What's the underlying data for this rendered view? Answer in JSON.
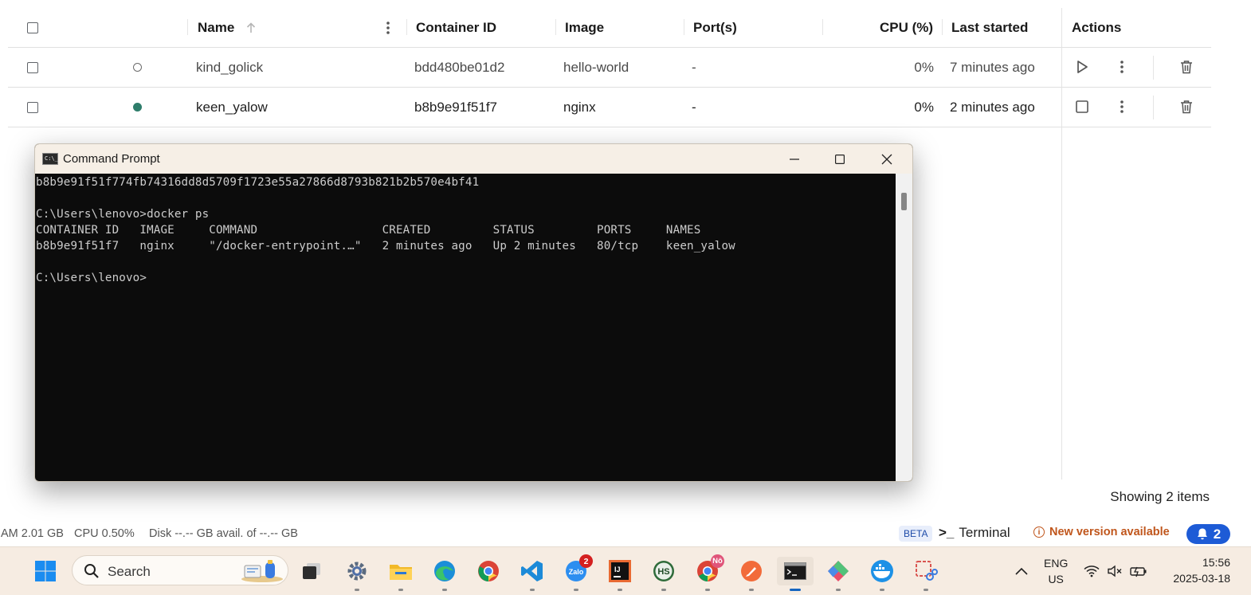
{
  "table": {
    "headers": {
      "name": "Name",
      "container_id": "Container ID",
      "image": "Image",
      "ports": "Port(s)",
      "cpu": "CPU (%)",
      "last_started": "Last started",
      "actions": "Actions"
    },
    "rows": [
      {
        "status": "stopped",
        "name": "kind_golick",
        "container_id": "bdd480be01d2",
        "image": "hello-world",
        "ports": "-",
        "cpu": "0%",
        "last_started": "7 minutes ago"
      },
      {
        "status": "running",
        "name": "keen_yalow",
        "container_id": "b8b9e91f51f7",
        "image": "nginx",
        "ports": "-",
        "cpu": "0%",
        "last_started": "2 minutes ago"
      }
    ],
    "showing": "Showing 2 items"
  },
  "footer": {
    "ram": "AM 2.01 GB",
    "cpu": "CPU 0.50%",
    "disk": "Disk --.-- GB avail. of --.-- GB",
    "beta": "BETA",
    "terminal_prompt": ">_",
    "terminal": "Terminal",
    "new_version": "New version available",
    "notifications": "2"
  },
  "cmd": {
    "title": "Command Prompt",
    "lines": [
      "b8b9e91f51f774fb74316dd8d5709f1723e55a27866d8793b821b2b570e4bf41",
      "",
      "C:\\Users\\lenovo>docker ps",
      "CONTAINER ID   IMAGE     COMMAND                  CREATED         STATUS         PORTS     NAMES",
      "b8b9e91f51f7   nginx     \"/docker-entrypoint.…\"   2 minutes ago   Up 2 minutes   80/tcp    keen_yalow",
      "",
      "C:\\Users\\lenovo>"
    ]
  },
  "taskbar": {
    "search_label": "Search",
    "zalo_badge": "2",
    "chrome_badge": "Nô",
    "lang": "ENG",
    "region": "US",
    "time": "15:56",
    "date": "2025-03-18"
  },
  "colors": {
    "running_dot": "#2e7d6b",
    "accent_blue": "#1d5bd6",
    "warning_orange": "#c0561c",
    "taskbar_bg": "#f6ece2"
  }
}
